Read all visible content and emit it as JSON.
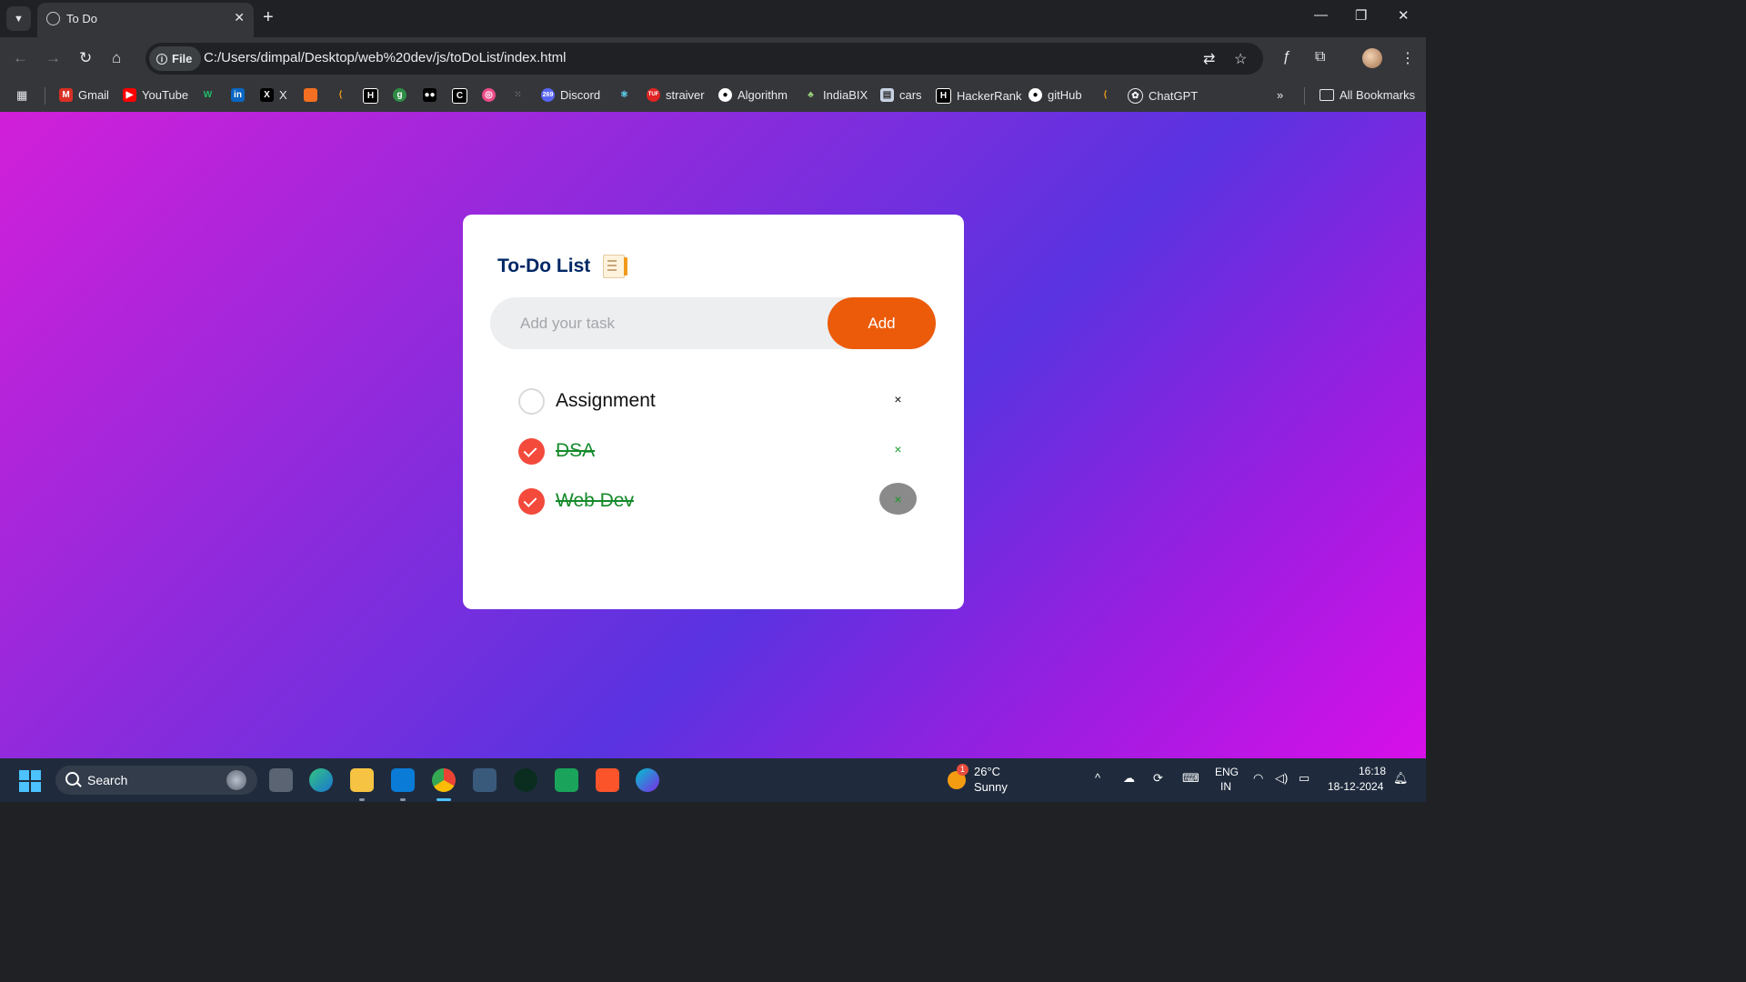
{
  "browser": {
    "tab_title": "To Do",
    "address_chip": "File",
    "url": "C:/Users/dimpal/Desktop/web%20dev/js/toDoList/index.html",
    "bookmarks": [
      "Gmail",
      "YouTube",
      "X",
      "Discord",
      "straiver",
      "Algorithm",
      "IndiaBIX",
      "cars",
      "HackerRank",
      "gitHub",
      "ChatGPT"
    ],
    "all_bookmarks": "All Bookmarks",
    "discord_badge": "269"
  },
  "app": {
    "title": "To-Do List",
    "input_placeholder": "Add your task",
    "add_label": "Add",
    "tasks": [
      {
        "text": "Assignment",
        "done": false
      },
      {
        "text": "DSA",
        "done": true
      },
      {
        "text": "Web Dev",
        "done": true
      }
    ],
    "delete_symbol": "×"
  },
  "taskbar": {
    "search_label": "Search",
    "weather_temp": "26°C",
    "weather_text": "Sunny",
    "weather_badge": "1",
    "lang_top": "ENG",
    "lang_bottom": "IN",
    "time": "16:18",
    "date": "18-12-2024"
  },
  "colors": {
    "accent": "#eb5b0a",
    "checked": "#f34a3b",
    "done_text": "#158a2a",
    "title": "#002765"
  }
}
